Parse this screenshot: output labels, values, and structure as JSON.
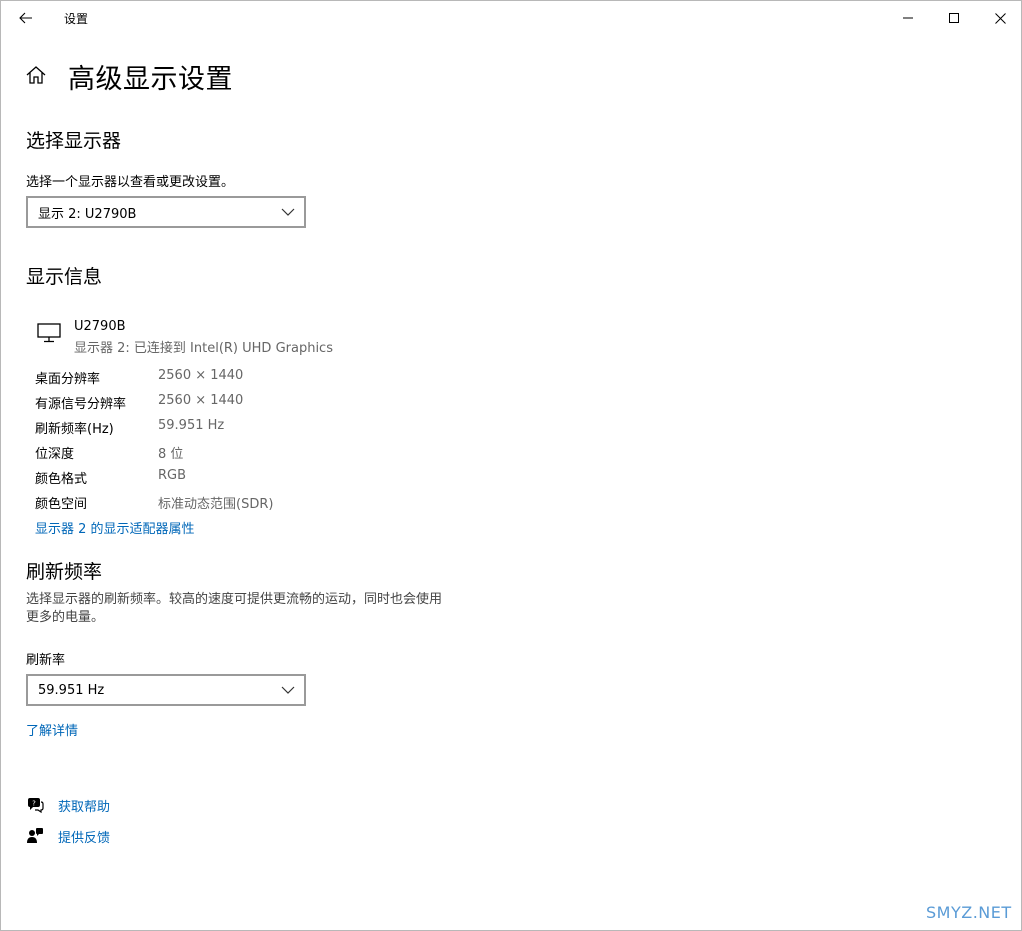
{
  "window": {
    "title": "设置"
  },
  "page": {
    "title": "高级显示设置"
  },
  "select_display": {
    "heading": "选择显示器",
    "prompt": "选择一个显示器以查看或更改设置。",
    "selected": "显示 2: U2790B"
  },
  "display_info": {
    "heading": "显示信息",
    "monitor_name": "U2790B",
    "monitor_sub": "显示器 2: 已连接到 Intel(R) UHD Graphics",
    "rows": [
      {
        "k": "桌面分辨率",
        "v": "2560 × 1440"
      },
      {
        "k": "有源信号分辨率",
        "v": "2560 × 1440"
      },
      {
        "k": "刷新频率(Hz)",
        "v": "59.951 Hz"
      },
      {
        "k": "位深度",
        "v": "8 位"
      },
      {
        "k": "颜色格式",
        "v": "RGB"
      },
      {
        "k": "颜色空间",
        "v": "标准动态范围(SDR)"
      }
    ],
    "adapter_link": "显示器 2 的显示适配器属性"
  },
  "refresh": {
    "heading": "刷新频率",
    "desc_line1": "选择显示器的刷新频率。较高的速度可提供更流畅的运动，同时也会使用",
    "desc_line2": "更多的电量。",
    "label": "刷新率",
    "selected": "59.951 Hz",
    "learn_more": "了解详情"
  },
  "help": {
    "get_help": "获取帮助",
    "feedback": "提供反馈"
  },
  "watermark": "SMYZ.NET",
  "colors": {
    "link": "#0067b8",
    "border": "#9a9a9a"
  }
}
